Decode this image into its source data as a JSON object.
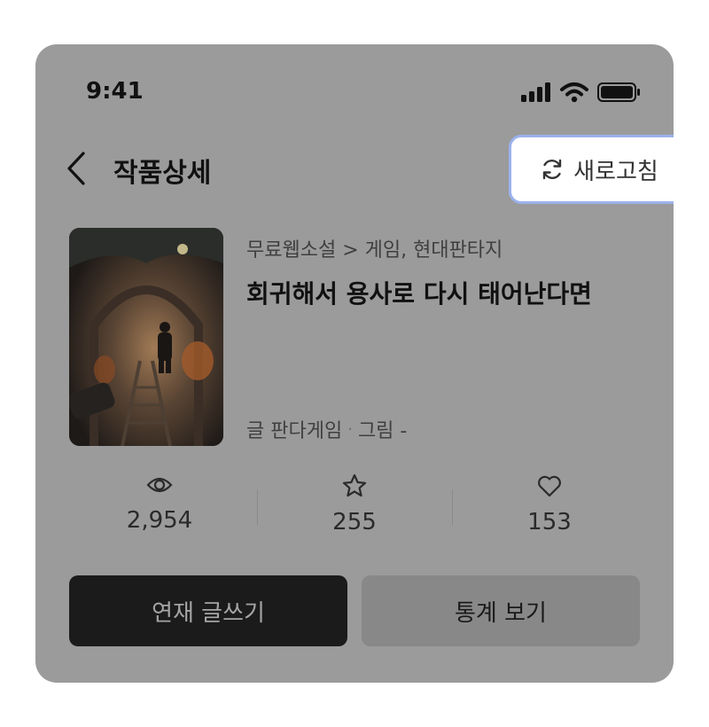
{
  "status_bar": {
    "time": "9:41",
    "icons": [
      "signal-icon",
      "wifi-icon",
      "battery-icon"
    ]
  },
  "header": {
    "title": "작품상세",
    "back_icon": "chevron-left-icon",
    "refresh_label": "새로고침",
    "refresh_icon": "refresh-icon"
  },
  "book": {
    "genre_path": "무료웹소설 > 게임, 현대판타지",
    "title": "회귀해서 용사로 다시 태어난다면",
    "writer_label": "글 판다게임",
    "separator": "·",
    "artist_label": "그림 -"
  },
  "stats": [
    {
      "icon": "eye-icon",
      "value": "2,954"
    },
    {
      "icon": "star-icon",
      "value": "255"
    },
    {
      "icon": "heart-icon",
      "value": "153"
    }
  ],
  "actions": {
    "write_label": "연재 글쓰기",
    "stats_label": "통계 보기"
  },
  "colors": {
    "overlay_bg": "#9b9b9b",
    "refresh_border": "#9bb2ec",
    "primary_button": "#1b1b1b",
    "secondary_button": "#888888"
  }
}
